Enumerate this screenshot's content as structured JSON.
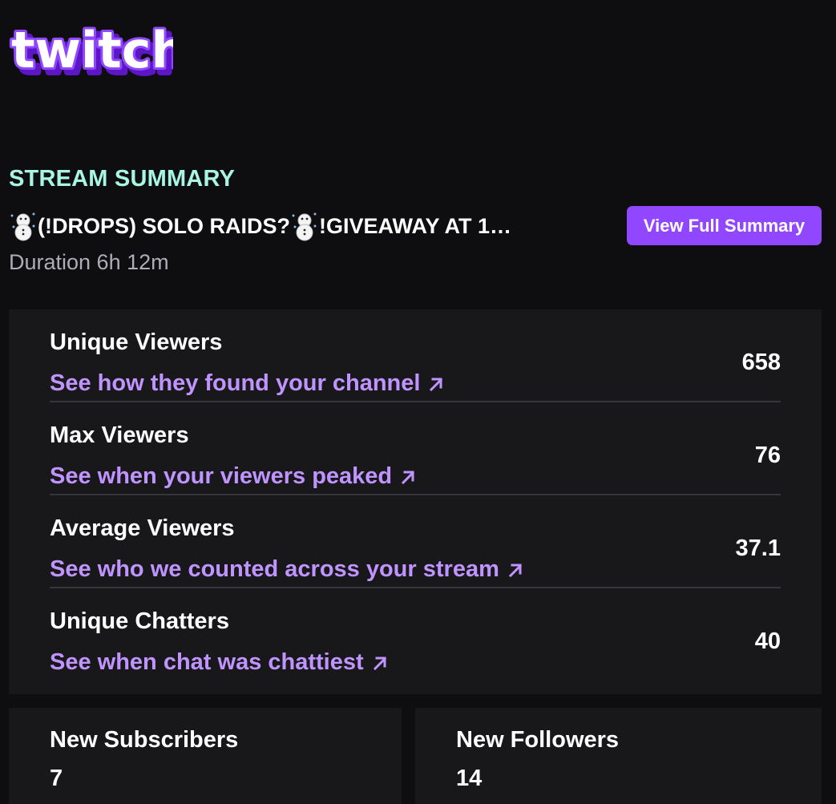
{
  "brand": {
    "logo_text": "twitch",
    "logo_color": "#9147ff"
  },
  "header": {
    "section_title": "STREAM SUMMARY",
    "stream_title": "(!DROPS) SOLO RAIDS?",
    "stream_title_rest": "!GIVEAWAY AT 1…",
    "duration": "Duration 6h 12m",
    "view_full_summary": "View Full Summary"
  },
  "stats": [
    {
      "label": "Unique Viewers",
      "link": "See how they found your channel",
      "value": "658"
    },
    {
      "label": "Max Viewers",
      "link": "See when your viewers peaked",
      "value": "76"
    },
    {
      "label": "Average Viewers",
      "link": "See who we counted across your stream",
      "value": "37.1"
    },
    {
      "label": "Unique Chatters",
      "link": "See when chat was chattiest",
      "value": "40"
    }
  ],
  "cards": [
    {
      "label": "New Subscribers",
      "value": "7"
    },
    {
      "label": "New Followers",
      "value": "14"
    }
  ],
  "colors": {
    "background": "#0e0e10",
    "card": "#18181b",
    "accent": "#9147ff",
    "link": "#bf94ff",
    "section_title": "#a9f5e4"
  },
  "icons": {
    "title_emoji": "snowman-icon",
    "link_arrow": "arrow-up-right-icon"
  }
}
